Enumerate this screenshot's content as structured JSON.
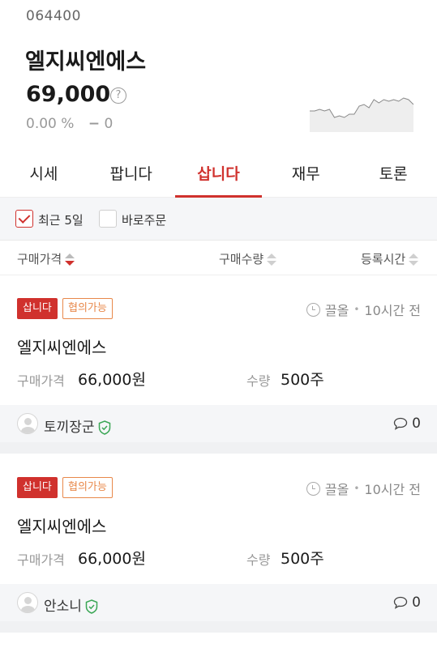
{
  "stock": {
    "code": "064400",
    "name": "엘지씨엔에스",
    "price": "69,000",
    "change_pct": "0.00 %",
    "change_amt": "0",
    "change_flat_symbol": "−",
    "spark_values": [
      62,
      62,
      63,
      62,
      63,
      58,
      59,
      58,
      60,
      60,
      65,
      66,
      64,
      69,
      67,
      69,
      68,
      69,
      68,
      70,
      69,
      66
    ]
  },
  "tabs": [
    {
      "label": "시세"
    },
    {
      "label": "팝니다"
    },
    {
      "label": "삽니다"
    },
    {
      "label": "재무"
    },
    {
      "label": "토론"
    }
  ],
  "active_tab": "삽니다",
  "filters": {
    "recent5": {
      "label": "최근 5일",
      "checked": true
    },
    "direct": {
      "label": "바로주문",
      "checked": false
    }
  },
  "sort": {
    "price": "구매가격",
    "qty": "구매수량",
    "time": "등록시간"
  },
  "listings": [
    {
      "badge": "삽니다",
      "tag": "협의가능",
      "time_status": "끌올",
      "time_ago": "10시간 전",
      "name": "엘지씨엔에스",
      "price_label": "구매가격",
      "price": "66,000원",
      "qty_label": "수량",
      "qty": "500주",
      "user": "토끼장군",
      "comments": "0"
    },
    {
      "badge": "삽니다",
      "tag": "협의가능",
      "time_status": "끌올",
      "time_ago": "10시간 전",
      "name": "엘지씨엔에스",
      "price_label": "구매가격",
      "price": "66,000원",
      "qty_label": "수량",
      "qty": "500주",
      "user": "안소니",
      "comments": "0"
    }
  ],
  "colors": {
    "accent": "#d0312d",
    "tag": "#e8884a",
    "verified": "#3aa655"
  }
}
